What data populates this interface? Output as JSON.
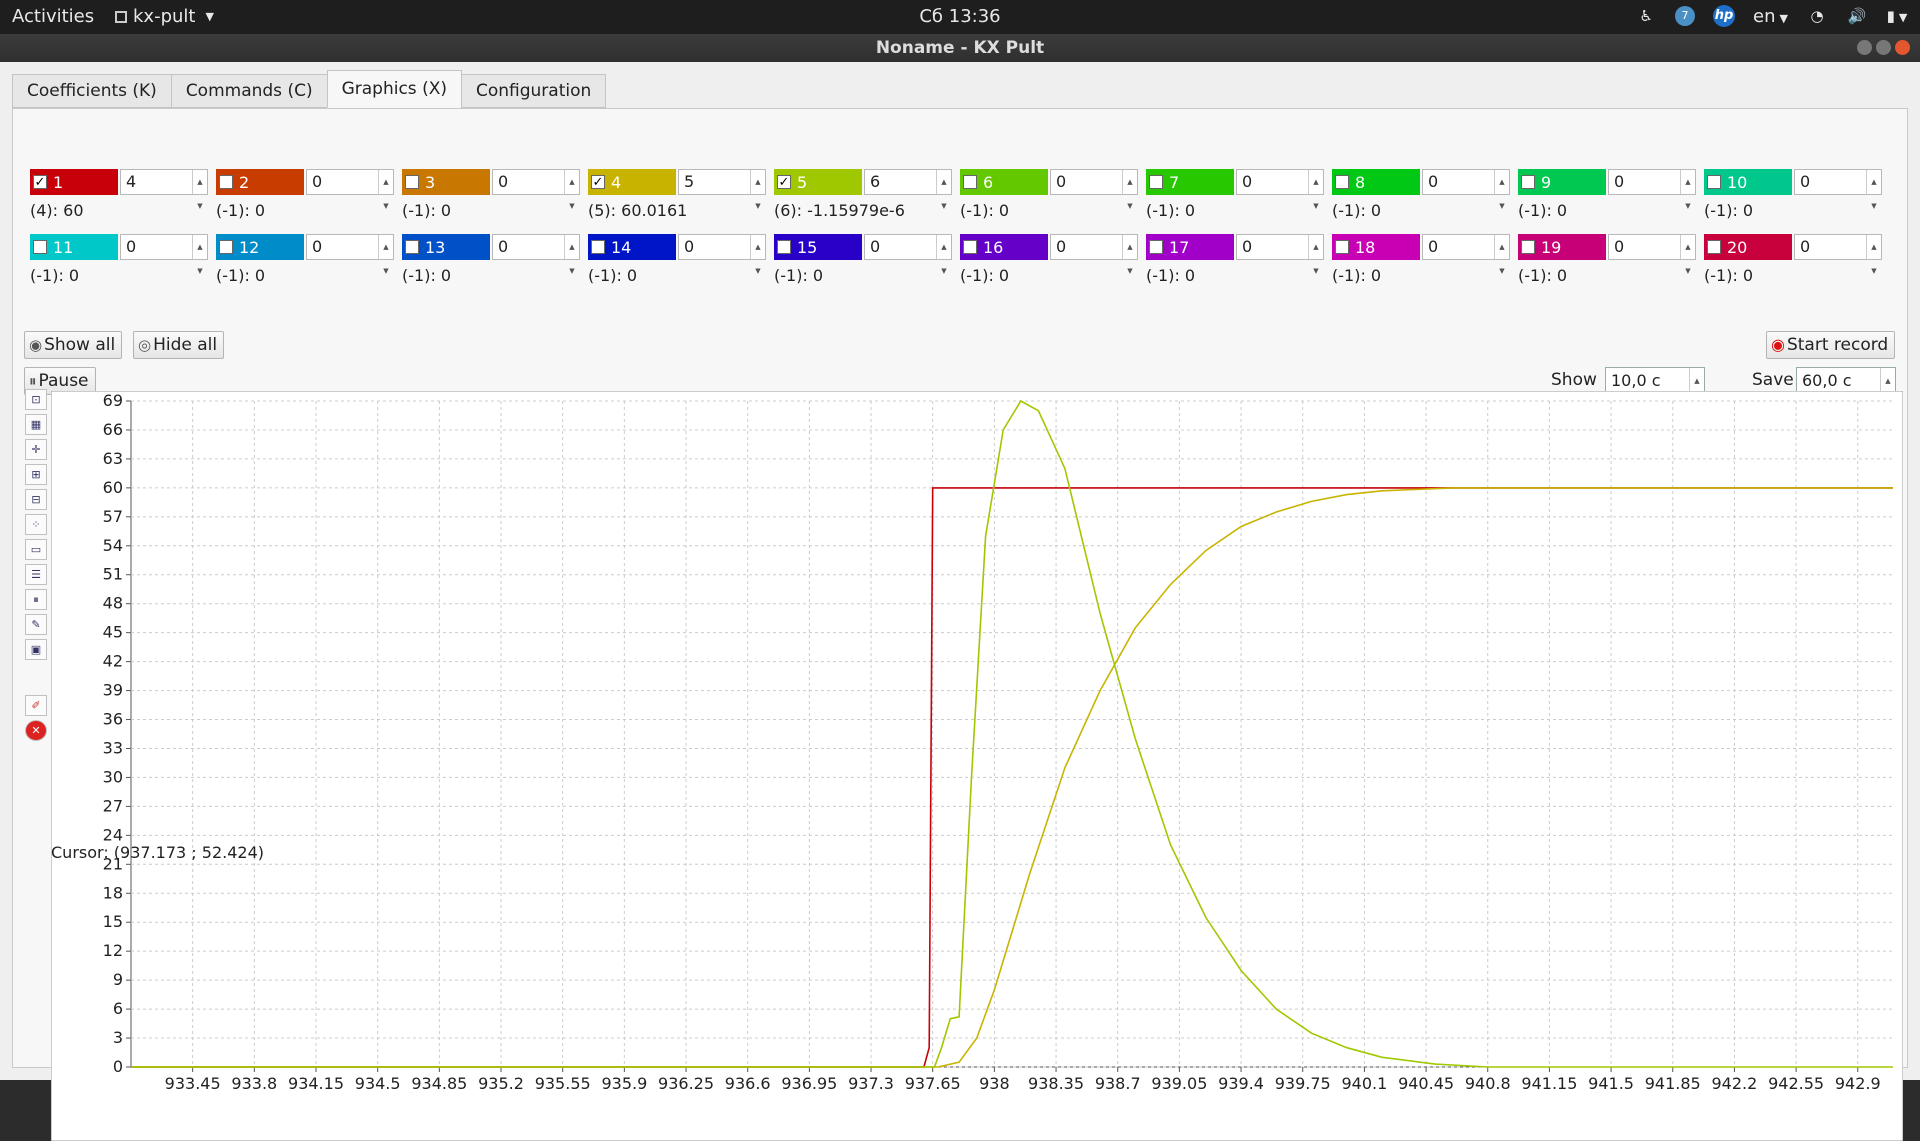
{
  "topbar": {
    "activities": "Activities",
    "app_name": "kx-pult",
    "clock": "Сб 13:36",
    "badge_number": "7",
    "hp_label": "hp",
    "language": "en"
  },
  "window": {
    "title": "Noname - KX Pult"
  },
  "tabs": [
    {
      "label": "Coefficients (K)"
    },
    {
      "label": "Commands (C)"
    },
    {
      "label": "Graphics (X)",
      "active": true
    },
    {
      "label": "Configuration"
    }
  ],
  "channels": [
    {
      "num": "1",
      "color": "#c8000a",
      "checked": true,
      "spin": "4",
      "value": "(4): 60"
    },
    {
      "num": "2",
      "color": "#c83c00",
      "checked": false,
      "spin": "0",
      "value": "(-1): 0"
    },
    {
      "num": "3",
      "color": "#c87800",
      "checked": false,
      "spin": "0",
      "value": "(-1): 0"
    },
    {
      "num": "4",
      "color": "#c8b400",
      "checked": true,
      "spin": "5",
      "value": "(5): 60.0161"
    },
    {
      "num": "5",
      "color": "#a0c800",
      "checked": true,
      "spin": "6",
      "value": "(6): -1.15979e-6"
    },
    {
      "num": "6",
      "color": "#64c800",
      "checked": false,
      "spin": "0",
      "value": "(-1): 0"
    },
    {
      "num": "7",
      "color": "#28c800",
      "checked": false,
      "spin": "0",
      "value": "(-1): 0"
    },
    {
      "num": "8",
      "color": "#00c814",
      "checked": false,
      "spin": "0",
      "value": "(-1): 0"
    },
    {
      "num": "9",
      "color": "#00c850",
      "checked": false,
      "spin": "0",
      "value": "(-1): 0"
    },
    {
      "num": "10",
      "color": "#00c88c",
      "checked": false,
      "spin": "0",
      "value": "(-1): 0"
    },
    {
      "num": "11",
      "color": "#00c8c8",
      "checked": false,
      "spin": "0",
      "value": "(-1): 0"
    },
    {
      "num": "12",
      "color": "#008cc8",
      "checked": false,
      "spin": "0",
      "value": "(-1): 0"
    },
    {
      "num": "13",
      "color": "#0050c8",
      "checked": false,
      "spin": "0",
      "value": "(-1): 0"
    },
    {
      "num": "14",
      "color": "#0014c8",
      "checked": false,
      "spin": "0",
      "value": "(-1): 0"
    },
    {
      "num": "15",
      "color": "#2800c8",
      "checked": false,
      "spin": "0",
      "value": "(-1): 0"
    },
    {
      "num": "16",
      "color": "#6400c8",
      "checked": false,
      "spin": "0",
      "value": "(-1): 0"
    },
    {
      "num": "17",
      "color": "#a000c8",
      "checked": false,
      "spin": "0",
      "value": "(-1): 0"
    },
    {
      "num": "18",
      "color": "#c800b4",
      "checked": false,
      "spin": "0",
      "value": "(-1): 0"
    },
    {
      "num": "19",
      "color": "#c80078",
      "checked": false,
      "spin": "0",
      "value": "(-1): 0"
    },
    {
      "num": "20",
      "color": "#c8003c",
      "checked": false,
      "spin": "0",
      "value": "(-1): 0"
    }
  ],
  "controls": {
    "show_all": "Show all",
    "hide_all": "Hide all",
    "pause": "Pause",
    "start_record": "Start record",
    "show_label": "Show",
    "show_value": "10,0 c",
    "save_label": "Save",
    "save_value": "60,0 c"
  },
  "cursor": "Cursor: (937.173 ; 52.424)",
  "chart_data": {
    "type": "line",
    "ylim": [
      0,
      69
    ],
    "xlim": [
      933.1,
      943.1
    ],
    "y_ticks": [
      0,
      3,
      6,
      9,
      12,
      15,
      18,
      21,
      24,
      27,
      30,
      33,
      36,
      39,
      42,
      45,
      48,
      51,
      54,
      57,
      60,
      63,
      66,
      69
    ],
    "x_ticks": [
      "933.45",
      "933.8",
      "934.15",
      "934.5",
      "934.85",
      "935.2",
      "935.55",
      "935.9",
      "936.25",
      "936.6",
      "936.95",
      "937.3",
      "937.65",
      "938",
      "938.35",
      "938.7",
      "939.05",
      "939.4",
      "939.75",
      "940.1",
      "940.45",
      "940.8",
      "941.15",
      "941.5",
      "941.85",
      "942.2",
      "942.55",
      "942.9"
    ],
    "series": [
      {
        "color": "#c8000a",
        "points": [
          [
            933.1,
            0
          ],
          [
            937.6,
            0
          ],
          [
            937.63,
            2
          ],
          [
            937.65,
            60
          ],
          [
            943.1,
            60
          ]
        ]
      },
      {
        "color": "#c8b400",
        "points": [
          [
            933.1,
            0
          ],
          [
            937.68,
            0
          ],
          [
            937.8,
            0.5
          ],
          [
            937.9,
            3
          ],
          [
            938.0,
            8
          ],
          [
            938.2,
            20
          ],
          [
            938.4,
            31
          ],
          [
            938.6,
            39
          ],
          [
            938.8,
            45.5
          ],
          [
            939.0,
            50
          ],
          [
            939.2,
            53.5
          ],
          [
            939.4,
            56
          ],
          [
            939.6,
            57.5
          ],
          [
            939.8,
            58.6
          ],
          [
            940.0,
            59.3
          ],
          [
            940.2,
            59.7
          ],
          [
            940.6,
            60
          ],
          [
            943.1,
            60
          ]
        ]
      },
      {
        "color": "#a0c800",
        "points": [
          [
            933.1,
            0
          ],
          [
            937.66,
            0
          ],
          [
            937.7,
            2
          ],
          [
            937.75,
            5
          ],
          [
            937.8,
            5.2
          ],
          [
            937.87,
            30
          ],
          [
            937.95,
            55
          ],
          [
            938.05,
            66
          ],
          [
            938.15,
            69
          ],
          [
            938.25,
            68
          ],
          [
            938.4,
            62
          ],
          [
            938.6,
            47
          ],
          [
            938.8,
            34
          ],
          [
            939.0,
            23
          ],
          [
            939.2,
            15.5
          ],
          [
            939.4,
            10
          ],
          [
            939.6,
            6
          ],
          [
            939.8,
            3.5
          ],
          [
            940.0,
            2
          ],
          [
            940.2,
            1
          ],
          [
            940.5,
            0.3
          ],
          [
            940.8,
            0
          ],
          [
            943.1,
            0
          ]
        ]
      }
    ]
  }
}
